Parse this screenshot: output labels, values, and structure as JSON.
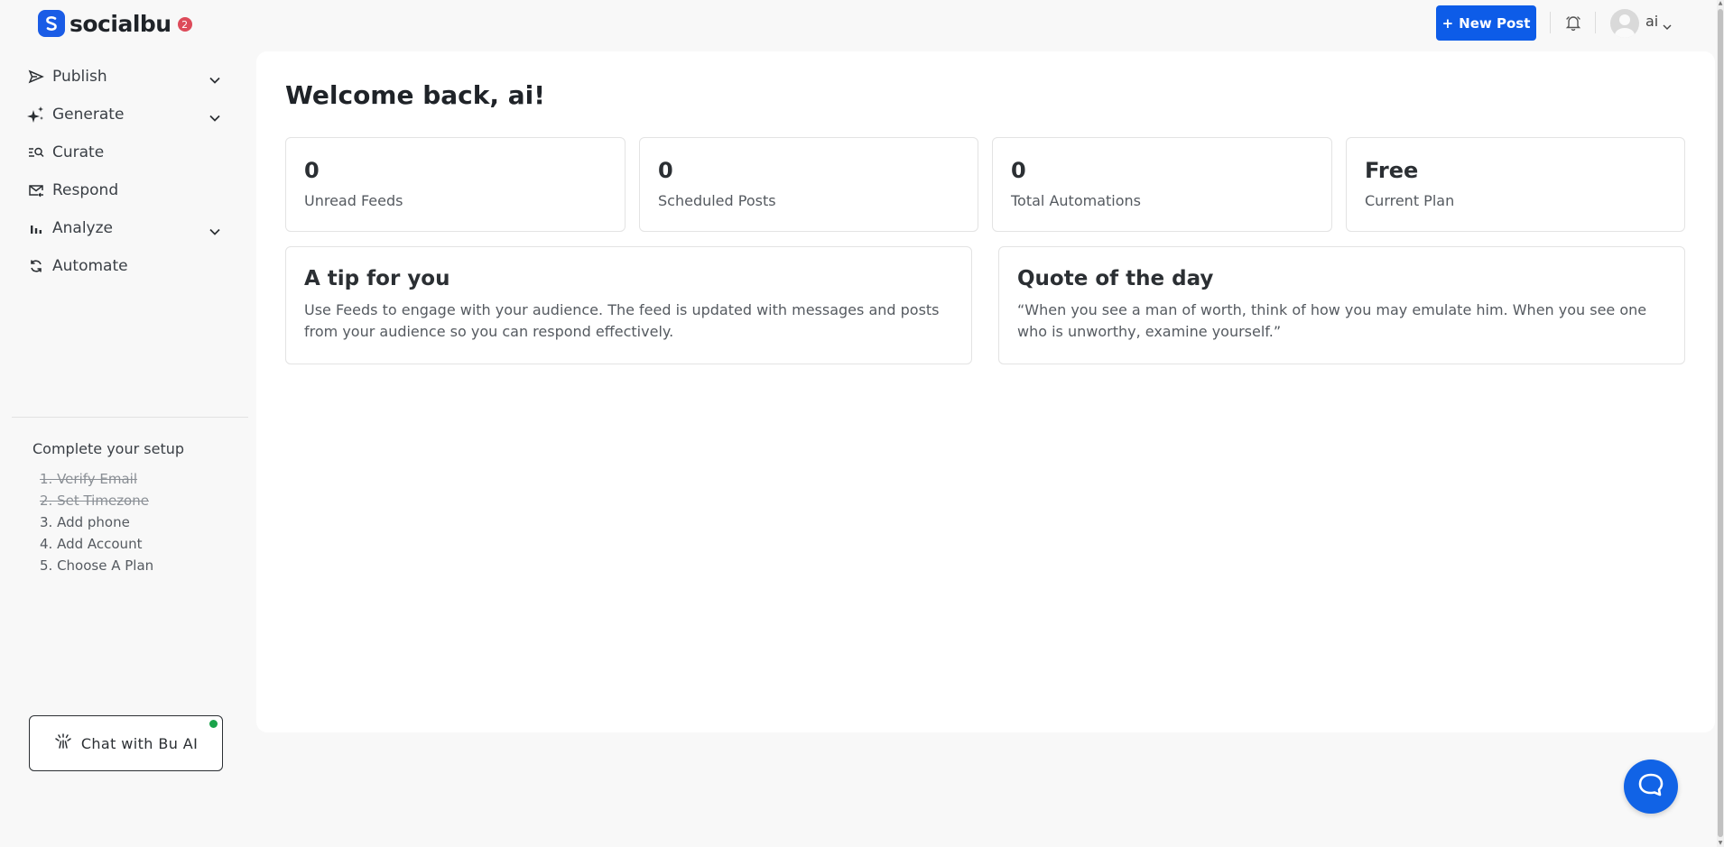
{
  "header": {
    "logo_text": "socialbu",
    "notification_count": "2",
    "new_post_label": "New Post",
    "new_post_icon": "+",
    "user_name": "ai"
  },
  "sidebar": {
    "items": [
      {
        "label": "Publish",
        "icon": "send-icon",
        "has_submenu": true
      },
      {
        "label": "Generate",
        "icon": "sparkles-icon",
        "has_submenu": true
      },
      {
        "label": "Curate",
        "icon": "search-list-icon",
        "has_submenu": false
      },
      {
        "label": "Respond",
        "icon": "mail-reply-icon",
        "has_submenu": false
      },
      {
        "label": "Analyze",
        "icon": "bar-chart-icon",
        "has_submenu": true
      },
      {
        "label": "Automate",
        "icon": "refresh-icon",
        "has_submenu": false
      }
    ],
    "setup": {
      "title": "Complete your setup",
      "steps": [
        {
          "label": "1. Verify Email",
          "done": true
        },
        {
          "label": "2. Set Timezone",
          "done": true
        },
        {
          "label": "3. Add phone",
          "done": false
        },
        {
          "label": "4. Add Account",
          "done": false
        },
        {
          "label": "5. Choose A Plan",
          "done": false
        }
      ]
    },
    "chat_label": "Chat with Bu AI"
  },
  "main": {
    "welcome": "Welcome back, ai!",
    "stats": [
      {
        "value": "0",
        "label": "Unread Feeds"
      },
      {
        "value": "0",
        "label": "Scheduled Posts"
      },
      {
        "value": "0",
        "label": "Total Automations"
      },
      {
        "value": "Free",
        "label": "Current Plan"
      }
    ],
    "tip": {
      "title": "A tip for you",
      "text": "Use Feeds to engage with your audience. The feed is updated with messages and posts from your audience so you can respond effectively."
    },
    "quote": {
      "title": "Quote of the day",
      "text": "“When you see a man of worth, think of how you may emulate him. When you see one who is unworthy, examine yourself.”"
    }
  },
  "colors": {
    "primary": "#0d5ce8",
    "badge": "#dd4b5a",
    "online": "#1aa34a",
    "background": "#f8f8f8"
  }
}
